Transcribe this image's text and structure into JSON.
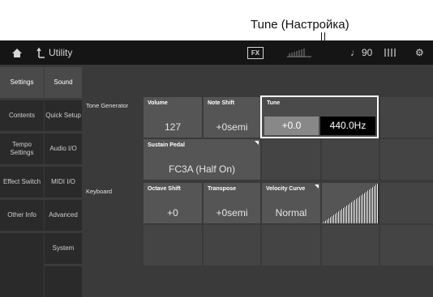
{
  "callout": {
    "text": "Tune (Настройка)"
  },
  "topbar": {
    "title": "Utility",
    "fx_label": "FX",
    "tempo": "90",
    "note_symbol": "♩"
  },
  "left_tabs": [
    {
      "label": "Settings",
      "active": true
    },
    {
      "label": "Contents",
      "active": false
    },
    {
      "label": "Tempo Settings",
      "active": false
    },
    {
      "label": "Effect Switch",
      "active": false
    },
    {
      "label": "Other Info",
      "active": false
    }
  ],
  "sub_tabs": [
    {
      "label": "Sound",
      "active": true
    },
    {
      "label": "Quick Setup",
      "active": false
    },
    {
      "label": "Audio I/O",
      "active": false
    },
    {
      "label": "MIDI I/O",
      "active": false
    },
    {
      "label": "Advanced",
      "active": false
    },
    {
      "label": "System",
      "active": false
    }
  ],
  "sections": {
    "tone_generator": "Tone Generator",
    "keyboard": "Keyboard"
  },
  "params": {
    "volume": {
      "label": "Volume",
      "value": "127"
    },
    "note_shift": {
      "label": "Note Shift",
      "value": "+0semi"
    },
    "tune": {
      "label": "Tune",
      "value": "+0.0",
      "hz": "440.0Hz"
    },
    "sustain_pedal": {
      "label": "Sustain Pedal",
      "value": "FC3A (Half On)"
    },
    "octave_shift": {
      "label": "Octave Shift",
      "value": "+0"
    },
    "transpose": {
      "label": "Transpose",
      "value": "+0semi"
    },
    "velocity_curve": {
      "label": "Velocity Curve",
      "value": "Normal"
    }
  }
}
